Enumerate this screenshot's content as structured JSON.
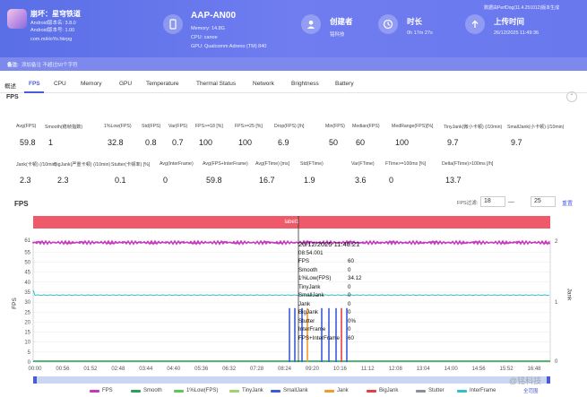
{
  "header": {
    "app_name": "崩坏：星穹铁道",
    "app_ver1": "Android版本名: 3.8.0",
    "app_ver2": "Android版本号: 1.00",
    "app_pkg": "com.miHoYo.hkrpg",
    "device_name": "AAP-AN00",
    "device_memory": "Memory: 14.8G",
    "device_cpu": "CPU: canoe",
    "device_gpu": "GPU: Qualcomm Adreno (TM) 840",
    "creator_title": "创建者",
    "creator_value": "铭科技",
    "duration_title": "时长",
    "duration_value": "0h 17m 27s",
    "upload_title": "上传时间",
    "upload_value": "26/12/2025 11:49:36",
    "perfdog_note": "数据由PerfDog(11.4.251012)版本生成"
  },
  "notes": {
    "label": "备注:",
    "placeholder": "添加备注    不超过50个字符"
  },
  "tabs": [
    "概述",
    "FPS",
    "CPU",
    "Memory",
    "GPU",
    "Temperature",
    "Thermal Status",
    "Network",
    "Brightness",
    "Battery"
  ],
  "section_title": "FPS",
  "metrics_row1": [
    {
      "label": "Avg(FPS)",
      "value": "59.8"
    },
    {
      "label": "Smooth(稳帧指数)",
      "value": "1"
    },
    {
      "label": "1%Low(FPS)",
      "value": "32.8"
    },
    {
      "label": "Std(FPS)",
      "value": "0.8"
    },
    {
      "label": "Var(FPS)",
      "value": "0.7"
    },
    {
      "label": "FPS>=18 [%]",
      "value": "100"
    },
    {
      "label": "FPS>=25 [%]",
      "value": "100"
    },
    {
      "label": "Drop(FPS) [/h]",
      "value": "6.9"
    },
    {
      "label": "Min(FPS)",
      "value": "50"
    },
    {
      "label": "Median(FPS)",
      "value": "60"
    },
    {
      "label": "MedRange(FPS)[%]",
      "value": "100"
    },
    {
      "label": "TinyJank(微小卡顿) (/10min)",
      "value": "9.7"
    },
    {
      "label": "SmallJank(小卡顿) (/10min)",
      "value": "9.7"
    }
  ],
  "metrics_row2": [
    {
      "label": "Jank(卡顿) (/10min)",
      "value": "2.3"
    },
    {
      "label": "BigJank(严重卡顿) (/10min)",
      "value": "2.3"
    },
    {
      "label": "Stutter(卡顿率) [%]",
      "value": "0.1"
    },
    {
      "label": "Avg(InterFrame)",
      "value": "0"
    },
    {
      "label": "Avg(FPS+InterFrame)",
      "value": "59.8"
    },
    {
      "label": "Avg(FTime) [ms]",
      "value": "16.7"
    },
    {
      "label": "Std(FTime)",
      "value": "1.9"
    },
    {
      "label": "Var(FTime)",
      "value": "3.6"
    },
    {
      "label": "FTime>=100ms [%]",
      "value": "0"
    },
    {
      "label": "Delta(FTime)>100ms [/h]",
      "value": "13.7"
    }
  ],
  "chart": {
    "title": "FPS",
    "filter_label": "FPS过滤:",
    "filter_min": "18",
    "filter_max": "25",
    "apply_label": "重置",
    "label_bar": "label1",
    "full_range_label": "全范围",
    "watermark": "@铭科技"
  },
  "chart_data": {
    "type": "line",
    "ylabel": "FPS",
    "y2label": "Jank",
    "ylim": [
      0,
      61
    ],
    "y2lim": [
      0,
      2
    ],
    "yticks": [
      "61",
      "55",
      "50",
      "45",
      "40",
      "35",
      "30",
      "25",
      "20",
      "15",
      "10",
      "5",
      "0"
    ],
    "y2ticks": [
      "2",
      "1",
      "0"
    ],
    "xticks": [
      "00:00",
      "00:56",
      "01:52",
      "02:48",
      "03:44",
      "04:40",
      "05:36",
      "06:32",
      "07:28",
      "08:24",
      "09:20",
      "10:16",
      "11:12",
      "12:08",
      "13:04",
      "14:00",
      "14:56",
      "15:52",
      "16:48"
    ],
    "series": [
      {
        "name": "FPS",
        "color": "#c23bbd"
      },
      {
        "name": "Smooth",
        "color": "#2e9e58"
      },
      {
        "name": "1%Low(FPS)",
        "color": "#5cc85a"
      },
      {
        "name": "TinyJank",
        "color": "#9bd46a"
      },
      {
        "name": "SmallJank",
        "color": "#3c5bdc"
      },
      {
        "name": "Jank",
        "color": "#f29a2e"
      },
      {
        "name": "BigJank",
        "color": "#e24040"
      },
      {
        "name": "Stutter",
        "color": "#8a8fa0"
      },
      {
        "name": "InterFrame",
        "color": "#2fc0c8"
      }
    ],
    "tooltip": {
      "time": "26/12/2025 11:40:21",
      "elapsed": "08:54.001",
      "rows": [
        {
          "k": "FPS",
          "v": "60"
        },
        {
          "k": "Smooth",
          "v": "0"
        },
        {
          "k": "1%Low(FPS)",
          "v": "34.12"
        },
        {
          "k": "TinyJank",
          "v": "0"
        },
        {
          "k": "SmallJank",
          "v": "0"
        },
        {
          "k": "Jank",
          "v": "0"
        },
        {
          "k": "BigJank",
          "v": "0"
        },
        {
          "k": "Stutter",
          "v": "0%"
        },
        {
          "k": "InterFrame",
          "v": "0"
        },
        {
          "k": "FPS+InterFrame",
          "v": "60"
        }
      ]
    }
  }
}
